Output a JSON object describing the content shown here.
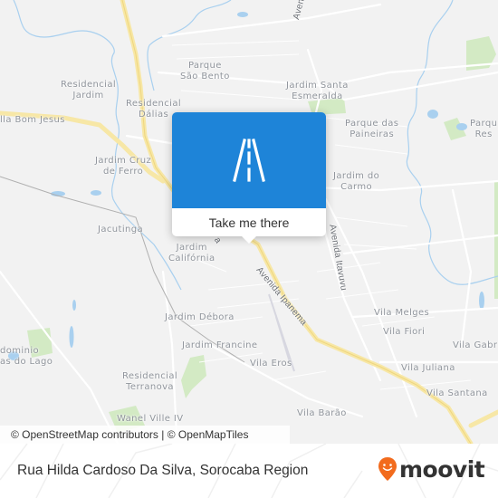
{
  "map": {
    "places": [
      {
        "id": "parque-sao-bento",
        "lines": [
          "Parque",
          "São Bento"
        ]
      },
      {
        "id": "residencial-jardim",
        "lines": [
          "Residencial",
          "Jardim"
        ]
      },
      {
        "id": "residencial-dalias",
        "lines": [
          "Residencial",
          "Dálias"
        ]
      },
      {
        "id": "vila-bom-jesus",
        "lines": [
          "lla Bom Jesus"
        ]
      },
      {
        "id": "jardim-cruz-de-ferro",
        "lines": [
          "Jardim Cruz",
          "de Ferro"
        ]
      },
      {
        "id": "jardim-santa-esmeralda",
        "lines": [
          "Jardim Santa",
          "Esmeralda"
        ]
      },
      {
        "id": "parque-das-paineiras",
        "lines": [
          "Parque das",
          "Paineiras"
        ]
      },
      {
        "id": "parque-res",
        "lines": [
          "Parqu",
          "Res"
        ]
      },
      {
        "id": "jardim-do-carmo",
        "lines": [
          "Jardim do",
          "Carmo"
        ]
      },
      {
        "id": "jacutinga",
        "lines": [
          "Jacutinga"
        ]
      },
      {
        "id": "jardim-california",
        "lines": [
          "Jardim",
          "Califórnia"
        ]
      },
      {
        "id": "jardim-debora",
        "lines": [
          "Jardim Débora"
        ]
      },
      {
        "id": "jardim-francine",
        "lines": [
          "Jardim Francine"
        ]
      },
      {
        "id": "condominio",
        "lines": [
          "dominio",
          "as do Lago"
        ]
      },
      {
        "id": "residencial-terranova",
        "lines": [
          "Residencial",
          "Terranova"
        ]
      },
      {
        "id": "wanel-ville-iv",
        "lines": [
          "Wanel Ville IV"
        ]
      },
      {
        "id": "vila-melges",
        "lines": [
          "Vila Melges"
        ]
      },
      {
        "id": "vila-fiori",
        "lines": [
          "Vila Fiori"
        ]
      },
      {
        "id": "vila-gabr",
        "lines": [
          "Vila Gabr"
        ]
      },
      {
        "id": "vila-eros",
        "lines": [
          "Vila Eros"
        ]
      },
      {
        "id": "vila-juliana",
        "lines": [
          "Vila Juliana"
        ]
      },
      {
        "id": "vila-santana",
        "lines": [
          "Vila Santana"
        ]
      },
      {
        "id": "vila-barao",
        "lines": [
          "Vila Barão"
        ]
      }
    ],
    "streets": {
      "avenida_it": "Avenida It",
      "avenida_itavuvu": "Avenida Itavuvu",
      "avenida_ipanema": "Avenida Ipanema",
      "avenida_stub": "a"
    },
    "colors": {
      "land": "#f2f2f2",
      "water": "#a9d0ef",
      "park": "#cfe8bf",
      "major_road": "#f7e7a6",
      "minor_road": "#ffffff"
    }
  },
  "popup": {
    "icon": "road-icon",
    "button_label": "Take me there",
    "color": "#1e84d8"
  },
  "attribution": "© OpenStreetMap contributors | © OpenMapTiles",
  "footer": {
    "title": "Rua Hilda Cardoso Da Silva, Sorocaba Region",
    "logo_text": "moovit",
    "logo_color": "#f26b1d"
  }
}
